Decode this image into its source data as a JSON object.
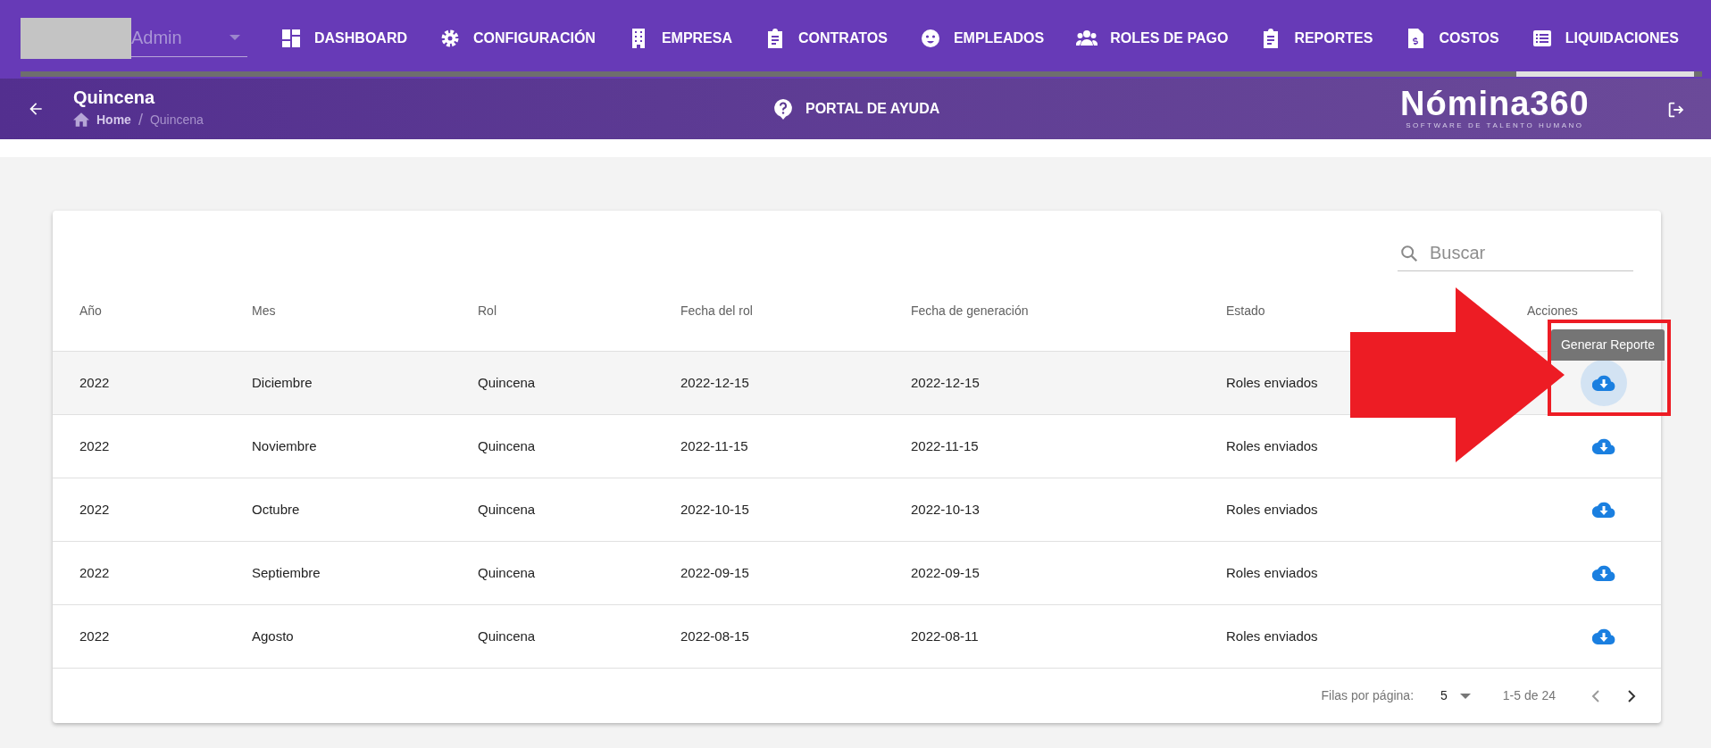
{
  "user": {
    "name": "Admin"
  },
  "nav": [
    {
      "label": "DASHBOARD",
      "selected": false
    },
    {
      "label": "CONFIGURACIÓN",
      "selected": false
    },
    {
      "label": "EMPRESA",
      "selected": false
    },
    {
      "label": "CONTRATOS",
      "selected": false
    },
    {
      "label": "EMPLEADOS",
      "selected": false
    },
    {
      "label": "ROLES DE PAGO",
      "selected": false
    },
    {
      "label": "REPORTES",
      "selected": false
    },
    {
      "label": "COSTOS",
      "selected": false
    },
    {
      "label": "LIQUIDACIONES",
      "selected": true
    }
  ],
  "header": {
    "title": "Quincena",
    "breadcrumb": [
      "Home",
      "Quincena"
    ],
    "breadcrumb_separator": "/",
    "help": "PORTAL DE AYUDA",
    "logo": "Nómina360",
    "logo_tagline": "SOFTWARE DE TALENTO HUMANO"
  },
  "search": {
    "placeholder": "Buscar"
  },
  "table": {
    "columns": [
      "Año",
      "Mes",
      "Rol",
      "Fecha del rol",
      "Fecha de generación",
      "Estado",
      "Acciones"
    ],
    "rows": [
      {
        "cells": [
          "2022",
          "Diciembre",
          "Quincena",
          "2022-12-15",
          "2022-12-15",
          "Roles enviados"
        ],
        "hovered": true
      },
      {
        "cells": [
          "2022",
          "Noviembre",
          "Quincena",
          "2022-11-15",
          "2022-11-15",
          "Roles enviados"
        ],
        "hovered": false
      },
      {
        "cells": [
          "2022",
          "Octubre",
          "Quincena",
          "2022-10-15",
          "2022-10-13",
          "Roles enviados"
        ],
        "hovered": false
      },
      {
        "cells": [
          "2022",
          "Septiembre",
          "Quincena",
          "2022-09-15",
          "2022-09-15",
          "Roles enviados"
        ],
        "hovered": false
      },
      {
        "cells": [
          "2022",
          "Agosto",
          "Quincena",
          "2022-08-15",
          "2022-08-11",
          "Roles enviados"
        ],
        "hovered": false
      }
    ]
  },
  "tooltip": "Generar Reporte",
  "pagination": {
    "rows_label": "Filas por página:",
    "rows_value": "5",
    "range": "1-5 de 24"
  }
}
